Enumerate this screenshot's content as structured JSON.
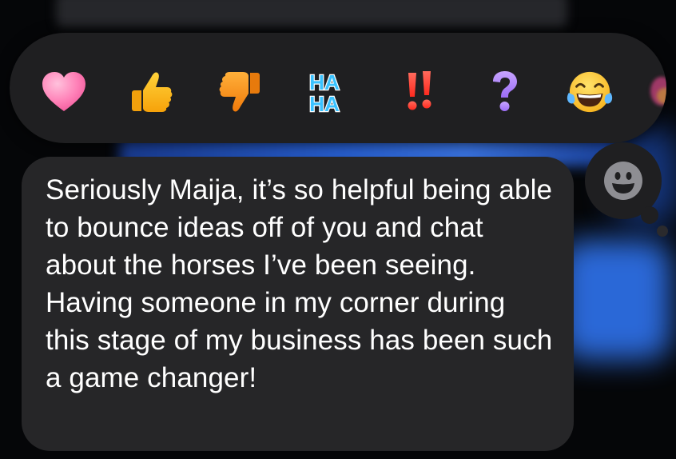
{
  "reaction_bar": {
    "reactions": [
      {
        "name": "heart",
        "icon": "heart-icon",
        "color": "#ff7fb6"
      },
      {
        "name": "thumbs-up",
        "icon": "thumbs-up-icon",
        "color": "#ffb400"
      },
      {
        "name": "thumbs-down",
        "icon": "thumbs-down-icon",
        "color": "#ff9a1a"
      },
      {
        "name": "haha",
        "icon": "haha-icon",
        "text_top": "HA",
        "text_bottom": "HA",
        "color": "#39c2ff"
      },
      {
        "name": "emphasize",
        "icon": "double-exclamation-icon",
        "color": "#ff3b30"
      },
      {
        "name": "question",
        "icon": "question-mark-icon",
        "color": "#b98cff"
      },
      {
        "name": "laugh",
        "icon": "tears-of-joy-icon",
        "color": "#ffc83d"
      },
      {
        "name": "more",
        "icon": "more-emoji-icon",
        "color": "#c0407a"
      }
    ]
  },
  "add_reaction": {
    "icon": "smiley-icon",
    "color": "#8e8e93"
  },
  "message": {
    "text": "Seriously Maija, it’s so helpful being able to bounce ideas off of you and chat about the horses I’ve been seeing. Having someone in my corner during this stage of my business has been such a game changer!"
  },
  "colors": {
    "bubble": "#262628",
    "bar": "#1f1f21",
    "background_accent": "#2f73ee"
  }
}
